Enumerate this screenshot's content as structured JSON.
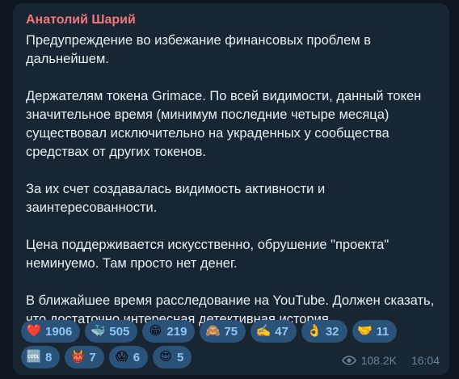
{
  "message": {
    "author": "Анатолий Шарий",
    "text": "Предупреждение  во избежание финансовых проблем в дальнейшем.\n\nДержателям токена Grimace. По всей видимости, данный токен значительное время (минимум последние четыре месяца) существовал исключительно на украденных у сообщества средствах от других токенов.\n\nЗа их счет создавалась видимость активности и заинтересованности.\n\nЦена поддерживается искусственно, обрушение \"проекта\" неминуемо. Там просто нет денег.\n\nВ ближайшее время расследование на YouTube. Должен сказать, что  достаточно интересная детективная история.",
    "views": "108.2K",
    "time": "16:04"
  },
  "reactions": [
    {
      "icon": "heart-icon",
      "emoji": "❤️",
      "count": "1906"
    },
    {
      "icon": "whale-icon",
      "emoji": "🐳",
      "count": "505"
    },
    {
      "icon": "grin-icon",
      "emoji": "😁",
      "count": "219"
    },
    {
      "icon": "monkey-icon",
      "emoji": "🙈",
      "count": "75"
    },
    {
      "icon": "writing-hand-icon",
      "emoji": "✍️",
      "count": "47"
    },
    {
      "icon": "ok-hand-icon",
      "emoji": "👌",
      "count": "32"
    },
    {
      "icon": "handshake-icon",
      "emoji": "🤝",
      "count": "11"
    },
    {
      "icon": "cool-icon",
      "emoji": "🆒",
      "count": "8"
    },
    {
      "icon": "devil-icon",
      "emoji": "👹",
      "count": "7"
    },
    {
      "icon": "screaming-face-icon",
      "emoji": "😱",
      "count": "6"
    },
    {
      "icon": "heart-eyes-icon",
      "emoji": "😍",
      "count": "5"
    }
  ],
  "colors": {
    "background": "#0e1621",
    "bubble": "#182533",
    "author": "#f0797a",
    "text": "#e9eef3",
    "reaction_bg": "#2b5278",
    "reaction_count": "#8fc6f5",
    "meta": "#6d8396"
  }
}
